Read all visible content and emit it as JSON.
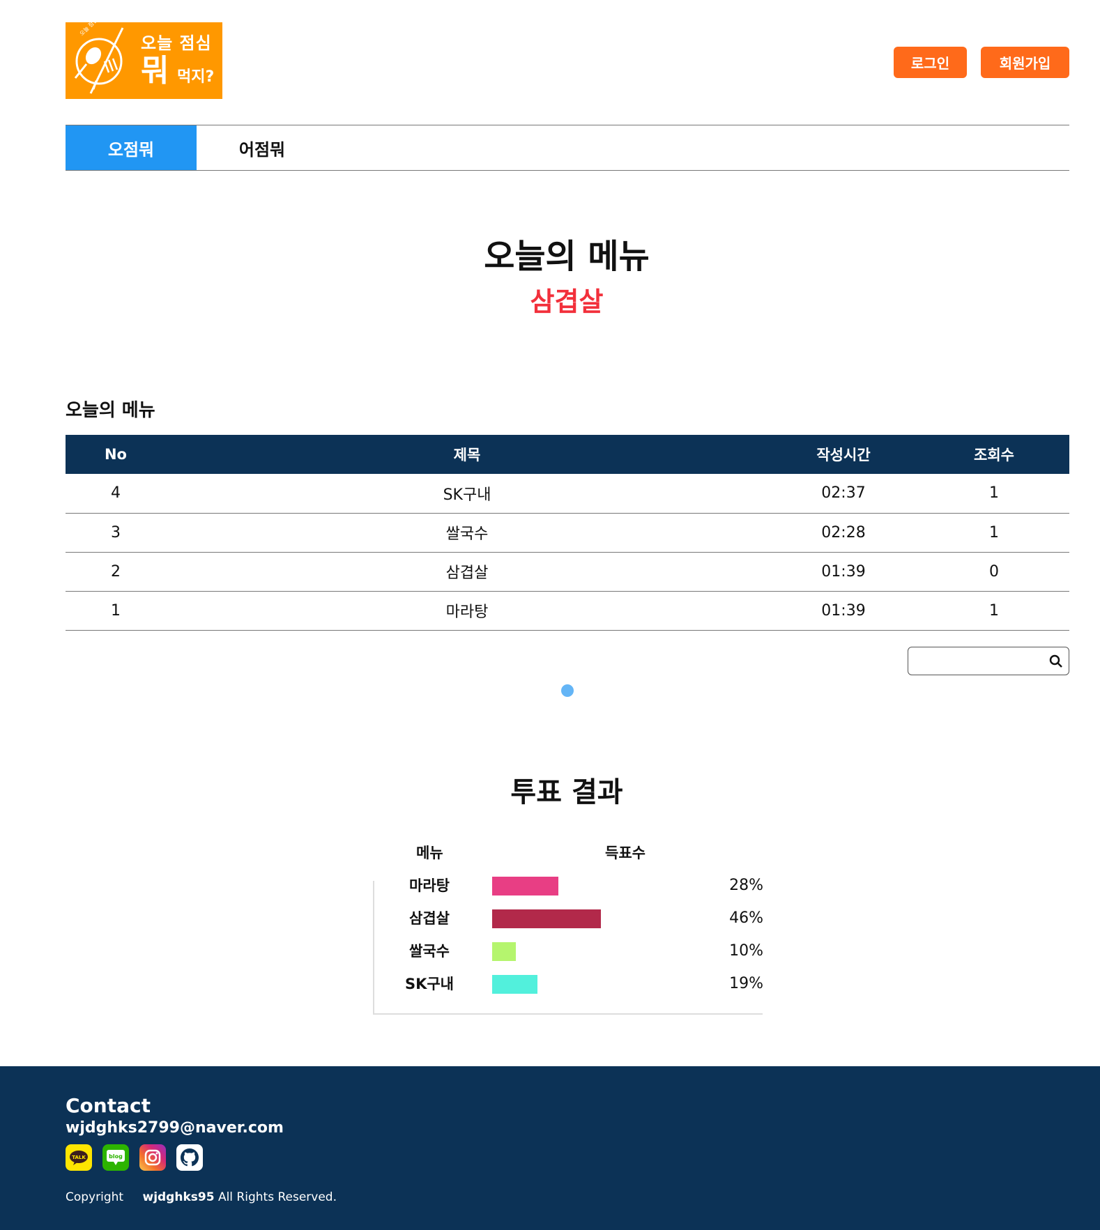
{
  "logo": {
    "line1": "오늘 점심",
    "line2": "뭐",
    "line3": "먹지?",
    "tiny": "오늘 점심 뭐 먹지?",
    "bg_color": "#ff9800"
  },
  "header": {
    "login_label": "로그인",
    "join_label": "회원가입",
    "button_color": "#ff6a1a"
  },
  "tabs": [
    {
      "label": "오점뭐",
      "active": true
    },
    {
      "label": "어점뭐",
      "active": false
    }
  ],
  "today": {
    "title": "오늘의 메뉴",
    "menu": "삼겹살",
    "menu_color": "#f2303b"
  },
  "board": {
    "section_title": "오늘의 메뉴",
    "headers": [
      "No",
      "제목",
      "작성시간",
      "조회수"
    ],
    "rows": [
      [
        "4",
        "SK구내",
        "02:37",
        "1"
      ],
      [
        "3",
        "쌀국수",
        "02:28",
        "1"
      ],
      [
        "2",
        "삼겹살",
        "01:39",
        "0"
      ],
      [
        "1",
        "마라탕",
        "01:39",
        "1"
      ]
    ],
    "header_color": "#0c3256"
  },
  "search": {
    "value": "",
    "icon": "search-icon"
  },
  "pagination": {
    "current_page": 1,
    "dot_color": "#64b5f6"
  },
  "vote": {
    "title": "투표 결과",
    "col_menu": "메뉴",
    "col_count": "득표수",
    "items": [
      {
        "name": "마라탕",
        "percent": 28,
        "label": "28%",
        "color": "#e83e84"
      },
      {
        "name": "삼겹살",
        "percent": 46,
        "label": "46%",
        "color": "#b2294a"
      },
      {
        "name": "쌀국수",
        "percent": 10,
        "label": "10%",
        "color": "#b5f56e"
      },
      {
        "name": "SK구내",
        "percent": 19,
        "label": "19%",
        "color": "#52f0dc"
      }
    ]
  },
  "footer": {
    "contact_title": "Contact",
    "email": "wjdghks2799@naver.com",
    "icons": [
      "kakaotalk-icon",
      "blog-icon",
      "instagram-icon",
      "github-icon"
    ],
    "kakao_text": "TALK",
    "blog_text": "blog",
    "copyright": "Copyright",
    "owner": "wjdghks95",
    "rights": "All Rights Reserved.",
    "bg_color": "#0c3256"
  }
}
